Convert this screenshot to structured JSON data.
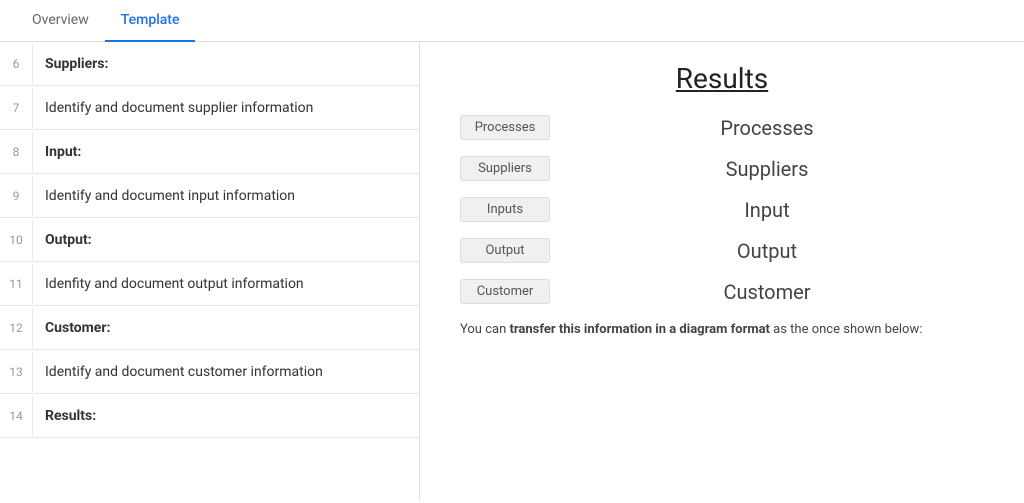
{
  "tabs": [
    {
      "id": "overview",
      "label": "Overview",
      "active": false
    },
    {
      "id": "template",
      "label": "Template",
      "active": true
    }
  ],
  "left_panel": {
    "rows": [
      {
        "number": "6",
        "content": "Suppliers:",
        "bold": true
      },
      {
        "number": "7",
        "content": "Identify and document supplier information",
        "bold": false
      },
      {
        "number": "8",
        "content": "Input:",
        "bold": true
      },
      {
        "number": "9",
        "content": "Identify and document input information",
        "bold": false
      },
      {
        "number": "10",
        "content": "Output:",
        "bold": true
      },
      {
        "number": "11",
        "content": "Idenfity and document output information",
        "bold": false
      },
      {
        "number": "12",
        "content": "Customer:",
        "bold": true
      },
      {
        "number": "13",
        "content": "Identify and document customer information",
        "bold": false
      },
      {
        "number": "14",
        "content": "Results:",
        "bold": true
      }
    ]
  },
  "right_panel": {
    "title": "Results",
    "pairs": [
      {
        "badge": "Processes",
        "label": "Processes"
      },
      {
        "badge": "Suppliers",
        "label": "Suppliers"
      },
      {
        "badge": "Inputs",
        "label": "Input"
      },
      {
        "badge": "Output",
        "label": "Output"
      },
      {
        "badge": "Customer",
        "label": "Customer"
      }
    ],
    "transfer_text_prefix": "You can ",
    "transfer_text_bold": "transfer this information in a diagram format",
    "transfer_text_suffix": " as the once shown below:"
  }
}
